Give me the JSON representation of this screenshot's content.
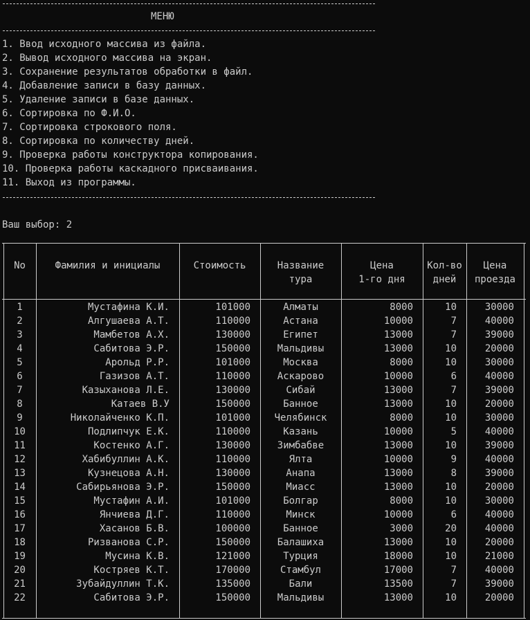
{
  "menu": {
    "title": "МЕНЮ",
    "items": [
      "1. Ввод исходного массива из файла.",
      "2. Вывод исходного массива на экран.",
      "3. Сохранение результатов обработки в файл.",
      "4. Добавление записи в базу данных.",
      "5. Удаление записи в базе данных.",
      "6. Сортировка по Ф.И.О.",
      "7. Сортировка строкового поля.",
      "8. Сортировка по количеству дней.",
      "9. Проверка работы конструктора копирования.",
      "10. Проверка работы каскадного присваивания.",
      "11. Выход из программы."
    ]
  },
  "prompt": {
    "label": "Ваш выбор: 2"
  },
  "table": {
    "headers": [
      [
        "No"
      ],
      [
        "Фамилия и инициалы"
      ],
      [
        "Стоимость"
      ],
      [
        "Название",
        "тура"
      ],
      [
        "Цена",
        "1-го дня"
      ],
      [
        "Кол-во",
        "дней"
      ],
      [
        "Цена",
        "проезда"
      ]
    ],
    "rows": [
      [
        "1",
        "Мустафина К.И.",
        "101000",
        "Алматы",
        "8000",
        "10",
        "30000"
      ],
      [
        "2",
        "Алгушаева А.Т.",
        "110000",
        "Астана",
        "10000",
        "7",
        "40000"
      ],
      [
        "3",
        "Мамбетов А.Х.",
        "130000",
        "Египет",
        "13000",
        "7",
        "39000"
      ],
      [
        "4",
        "Сабитова Э.Р.",
        "150000",
        "Мальдивы",
        "13000",
        "10",
        "20000"
      ],
      [
        "5",
        "Арольд Р.Р.",
        "101000",
        "Москва",
        "8000",
        "10",
        "30000"
      ],
      [
        "6",
        "Газизов А.Т.",
        "110000",
        "Аскарово",
        "10000",
        "6",
        "40000"
      ],
      [
        "7",
        "Казыханова Л.Е.",
        "130000",
        "Сибай",
        "13000",
        "7",
        "39000"
      ],
      [
        "8",
        "Катаев В.У",
        "150000",
        "Банное",
        "13000",
        "10",
        "20000"
      ],
      [
        "9",
        "Николайченко К.П.",
        "101000",
        "Челябинск",
        "8000",
        "10",
        "30000"
      ],
      [
        "10",
        "Подлипчук Е.К.",
        "110000",
        "Казань",
        "10000",
        "5",
        "40000"
      ],
      [
        "11",
        "Костенко А.Г.",
        "130000",
        "Зимбабве",
        "13000",
        "10",
        "39000"
      ],
      [
        "12",
        "Хабибуллин А.К.",
        "110000",
        "Ялта",
        "10000",
        "9",
        "40000"
      ],
      [
        "13",
        "Кузнецова А.Н.",
        "130000",
        "Анапа",
        "13000",
        "8",
        "39000"
      ],
      [
        "14",
        "Сабирьянова Э.Р.",
        "150000",
        "Миасс",
        "13000",
        "10",
        "20000"
      ],
      [
        "15",
        "Мустафин А.И.",
        "101000",
        "Болгар",
        "8000",
        "10",
        "30000"
      ],
      [
        "16",
        "Янчиева Д.Г.",
        "110000",
        "Минск",
        "10000",
        "6",
        "40000"
      ],
      [
        "17",
        "Хасанов Б.В.",
        "100000",
        "Банное",
        "3000",
        "20",
        "40000"
      ],
      [
        "18",
        "Ризванова С.Р.",
        "150000",
        "Балашиха",
        "13000",
        "10",
        "20000"
      ],
      [
        "19",
        "Мусина К.В.",
        "121000",
        "Турция",
        "18000",
        "10",
        "21000"
      ],
      [
        "20",
        "Костряев К.Т.",
        "170000",
        "Стамбул",
        "17000",
        "7",
        "40000"
      ],
      [
        "21",
        "Зубайдуллин Т.К.",
        "135000",
        "Бали",
        "13500",
        "7",
        "39000"
      ],
      [
        "22",
        "Сабитова Э.Р.",
        "150000",
        "Мальдивы",
        "13000",
        "10",
        "20000"
      ]
    ]
  }
}
